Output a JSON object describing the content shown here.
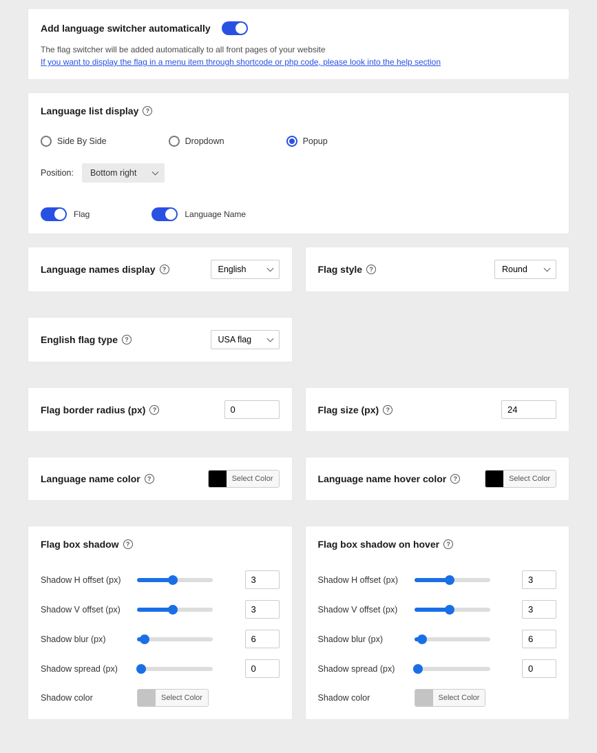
{
  "switcher": {
    "title": "Add language switcher automatically",
    "description": "The flag switcher will be added automatically to all front pages of your website",
    "help_link": "If you want to display the flag in a menu item through shortcode or php code, please look into the help section"
  },
  "list_display": {
    "title": "Language list display",
    "options": {
      "side_by_side": "Side By Side",
      "dropdown": "Dropdown",
      "popup": "Popup"
    },
    "position_label": "Position:",
    "position_value": "Bottom right",
    "flag_label": "Flag",
    "language_name_label": "Language Name"
  },
  "names_display": {
    "title": "Language names display",
    "value": "English"
  },
  "flag_style": {
    "title": "Flag style",
    "value": "Round"
  },
  "english_flag_type": {
    "title": "English flag type",
    "value": "USA flag"
  },
  "flag_border_radius": {
    "title": "Flag border radius (px)",
    "value": "0"
  },
  "flag_size": {
    "title": "Flag size (px)",
    "value": "24"
  },
  "lang_name_color": {
    "title": "Language name color",
    "button": "Select Color",
    "swatch": "#000000"
  },
  "lang_name_hover_color": {
    "title": "Language name hover color",
    "button": "Select Color",
    "swatch": "#000000"
  },
  "shadow": {
    "title": "Flag box shadow",
    "h_offset_label": "Shadow H offset (px)",
    "h_offset_value": "3",
    "h_offset_pct": 47,
    "v_offset_label": "Shadow V offset (px)",
    "v_offset_value": "3",
    "v_offset_pct": 47,
    "blur_label": "Shadow blur (px)",
    "blur_value": "6",
    "blur_pct": 10,
    "spread_label": "Shadow spread (px)",
    "spread_value": "0",
    "spread_pct": 5,
    "color_label": "Shadow color",
    "color_button": "Select Color",
    "color_swatch": "#c4c4c4"
  },
  "shadow_hover": {
    "title": "Flag box shadow on hover",
    "h_offset_label": "Shadow H offset (px)",
    "h_offset_value": "3",
    "h_offset_pct": 47,
    "v_offset_label": "Shadow V offset (px)",
    "v_offset_value": "3",
    "v_offset_pct": 47,
    "blur_label": "Shadow blur (px)",
    "blur_value": "6",
    "blur_pct": 10,
    "spread_label": "Shadow spread (px)",
    "spread_value": "0",
    "spread_pct": 5,
    "color_label": "Shadow color",
    "color_button": "Select Color",
    "color_swatch": "#c4c4c4"
  }
}
